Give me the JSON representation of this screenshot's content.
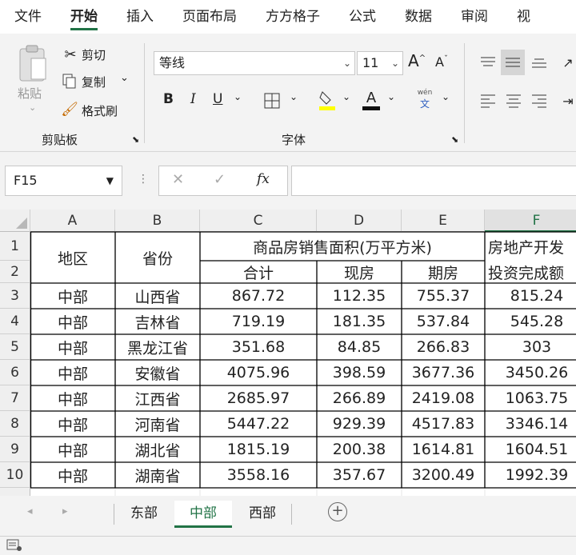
{
  "menu_tabs": [
    "文件",
    "开始",
    "插入",
    "页面布局",
    "方方格子",
    "公式",
    "数据",
    "审阅",
    "视"
  ],
  "clipboard": {
    "paste": "粘贴",
    "cut": "剪切",
    "copy": "复制",
    "painter": "格式刷",
    "group": "剪贴板"
  },
  "font": {
    "name": "等线",
    "size": "11",
    "bold": "B",
    "italic": "I",
    "underline": "U",
    "grow": "A",
    "shrink": "A",
    "color_letter": "A",
    "pinyin_top": "wén",
    "pinyin_bottom": "文",
    "group": "字体"
  },
  "formula_bar": {
    "cell_ref": "F15",
    "fx": "fx",
    "cancel": "✕",
    "confirm": "✓"
  },
  "columns": [
    "A",
    "B",
    "C",
    "D",
    "E",
    "F"
  ],
  "rows": [
    "1",
    "2",
    "3",
    "4",
    "5",
    "6",
    "7",
    "8",
    "9",
    "10"
  ],
  "header": {
    "region": "地区",
    "province": "省份",
    "sales_area": "商品房销售面积(万平方米)",
    "total": "合计",
    "existing": "现房",
    "future": "期房",
    "investment_1": "房地产开发",
    "investment_2": "投资完成额"
  },
  "data_rows": [
    [
      "中部",
      "山西省",
      "867.72",
      "112.35",
      "755.37",
      "815.24"
    ],
    [
      "中部",
      "吉林省",
      "719.19",
      "181.35",
      "537.84",
      "545.28"
    ],
    [
      "中部",
      "黑龙江省",
      "351.68",
      "84.85",
      "266.83",
      "303"
    ],
    [
      "中部",
      "安徽省",
      "4075.96",
      "398.59",
      "3677.36",
      "3450.26"
    ],
    [
      "中部",
      "江西省",
      "2685.97",
      "266.89",
      "2419.08",
      "1063.75"
    ],
    [
      "中部",
      "河南省",
      "5447.22",
      "929.39",
      "4517.83",
      "3346.14"
    ],
    [
      "中部",
      "湖北省",
      "1815.19",
      "200.38",
      "1614.81",
      "1604.51"
    ],
    [
      "中部",
      "湖南省",
      "3558.16",
      "357.67",
      "3200.49",
      "1992.39"
    ]
  ],
  "sheets": [
    "东部",
    "中部",
    "西部"
  ],
  "active_sheet": "中部",
  "accent": "#217346"
}
